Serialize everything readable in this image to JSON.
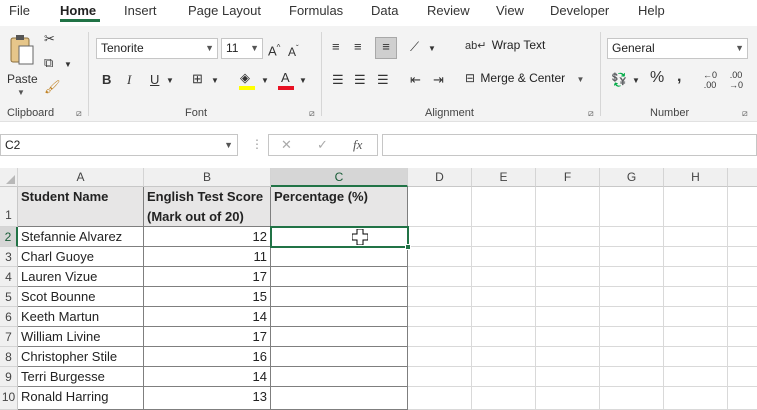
{
  "menu": {
    "tabs": [
      "File",
      "Home",
      "Insert",
      "Page Layout",
      "Formulas",
      "Data",
      "Review",
      "View",
      "Developer",
      "Help"
    ],
    "active": "Home"
  },
  "ribbon": {
    "clipboard": {
      "label": "Clipboard",
      "paste": "Paste"
    },
    "font": {
      "label": "Font",
      "name": "Tenorite",
      "size": "11",
      "bold": "B",
      "italic": "I",
      "underline": "U"
    },
    "alignment": {
      "label": "Alignment",
      "wrap_text": "Wrap Text",
      "merge_center": "Merge & Center"
    },
    "number": {
      "label": "Number",
      "format": "General"
    }
  },
  "formula_bar": {
    "name_box": "C2",
    "formula": ""
  },
  "colors": {
    "accent": "#217346",
    "header_fill": "#e7e6e6",
    "font_color": "#e81123",
    "highlight": "#ffff00"
  },
  "sheet": {
    "columns": [
      "A",
      "B",
      "C",
      "D",
      "E",
      "F",
      "G",
      "H"
    ],
    "rows": [
      "1",
      "2",
      "3",
      "4",
      "5",
      "6",
      "7",
      "8",
      "9",
      "10"
    ],
    "selected_cell": "C2",
    "headers": {
      "a": "Student Name",
      "b_line1": "English Test Score",
      "b_line2": "(Mark out of 20)",
      "c": "Percentage (%)"
    },
    "students": [
      {
        "name": "Stefannie Alvarez",
        "score": "12"
      },
      {
        "name": "Charl Guoye",
        "score": "11"
      },
      {
        "name": "Lauren Vizue",
        "score": "17"
      },
      {
        "name": "Scot Bounne",
        "score": "15"
      },
      {
        "name": "Keeth Martun",
        "score": "14"
      },
      {
        "name": "William Livine",
        "score": "17"
      },
      {
        "name": "Christopher Stile",
        "score": "16"
      },
      {
        "name": "Terri Burgesse",
        "score": "14"
      },
      {
        "name": "Ronald Harring",
        "score": "13"
      }
    ]
  }
}
